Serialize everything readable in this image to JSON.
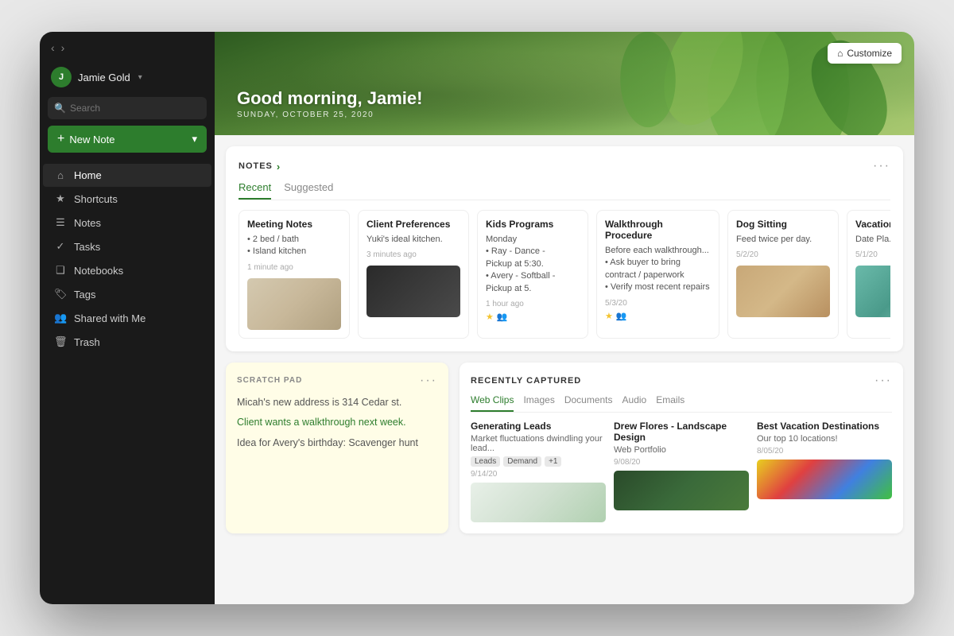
{
  "sidebar": {
    "nav_back": "‹",
    "nav_forward": "›",
    "user": {
      "initials": "J",
      "name": "Jamie Gold",
      "chevron": "▾"
    },
    "search_placeholder": "Search",
    "new_note_label": "New Note",
    "nav_items": [
      {
        "id": "home",
        "icon": "⌂",
        "label": "Home",
        "active": true
      },
      {
        "id": "shortcuts",
        "icon": "★",
        "label": "Shortcuts"
      },
      {
        "id": "notes",
        "icon": "☰",
        "label": "Notes"
      },
      {
        "id": "tasks",
        "icon": "✓",
        "label": "Tasks"
      },
      {
        "id": "notebooks",
        "icon": "❑",
        "label": "Notebooks"
      },
      {
        "id": "tags",
        "icon": "🏷",
        "label": "Tags"
      },
      {
        "id": "shared",
        "icon": "👥",
        "label": "Shared with Me"
      },
      {
        "id": "trash",
        "icon": "🗑",
        "label": "Trash"
      }
    ]
  },
  "hero": {
    "greeting": "Good morning, Jamie!",
    "date": "SUNDAY, OCTOBER 25, 2020",
    "customize_label": "Customize",
    "customize_icon": "⌂"
  },
  "notes_section": {
    "title": "NOTES",
    "tabs": [
      "Recent",
      "Suggested"
    ],
    "active_tab": "Recent",
    "cards": [
      {
        "title": "Meeting Notes",
        "body_lines": [
          "• 2 bed / bath",
          "• Island kitchen"
        ],
        "meta": "1 minute ago",
        "has_image": true,
        "img_class": "img-living-room"
      },
      {
        "title": "Client Preferences",
        "body_lines": [
          "Yuki's ideal kitchen."
        ],
        "meta": "3 minutes ago",
        "has_image": true,
        "img_class": "img-kitchen"
      },
      {
        "title": "Kids Programs",
        "body_lines": [
          "Monday",
          "• Ray - Dance -",
          "Pickup at 5:30.",
          "• Avery - Softball -",
          "Pickup at 5."
        ],
        "meta": "1 hour ago",
        "has_tags": true,
        "has_image": false
      },
      {
        "title": "Walkthrough Procedure",
        "body_lines": [
          "Before each walkthrough...",
          "• Ask buyer to bring contract / paperwork",
          "• Verify most recent repairs"
        ],
        "meta": "5/3/20",
        "has_tags": true,
        "has_image": false
      },
      {
        "title": "Dog Sitting",
        "body_lines": [
          "Feed twice per day."
        ],
        "meta": "5/2/20",
        "has_image": true,
        "img_class": "img-dog"
      },
      {
        "title": "Vacation Date",
        "body_lines": [
          "Date Pla..."
        ],
        "meta": "5/1/20",
        "has_image": true,
        "img_class": "img-teal"
      }
    ]
  },
  "scratch_pad": {
    "title": "SCRATCH PAD",
    "lines": [
      {
        "text": "Micah's new address is 314 Cedar st.",
        "highlight": false
      },
      {
        "text": "Client wants a walkthrough next week.",
        "highlight": true
      },
      {
        "text": "Idea for Avery's birthday: Scavenger hunt",
        "highlight": false
      }
    ]
  },
  "recently_captured": {
    "title": "RECENTLY CAPTURED",
    "tabs": [
      "Web Clips",
      "Images",
      "Documents",
      "Audio",
      "Emails"
    ],
    "active_tab": "Web Clips",
    "cards": [
      {
        "title": "Generating Leads",
        "body": "Market fluctuations dwindling your lead...",
        "tags": [
          "Leads",
          "Demand",
          "+1"
        ],
        "date": "9/14/20",
        "img_class": "img-leads"
      },
      {
        "title": "Drew Flores - Landscape Design",
        "body": "Web Portfolio",
        "tags": [],
        "date": "9/08/20",
        "img_class": "img-garden"
      },
      {
        "title": "Best Vacation Destinations",
        "body": "Our top 10 locations!",
        "tags": [],
        "date": "8/05/20",
        "img_class": "img-houses"
      }
    ]
  }
}
